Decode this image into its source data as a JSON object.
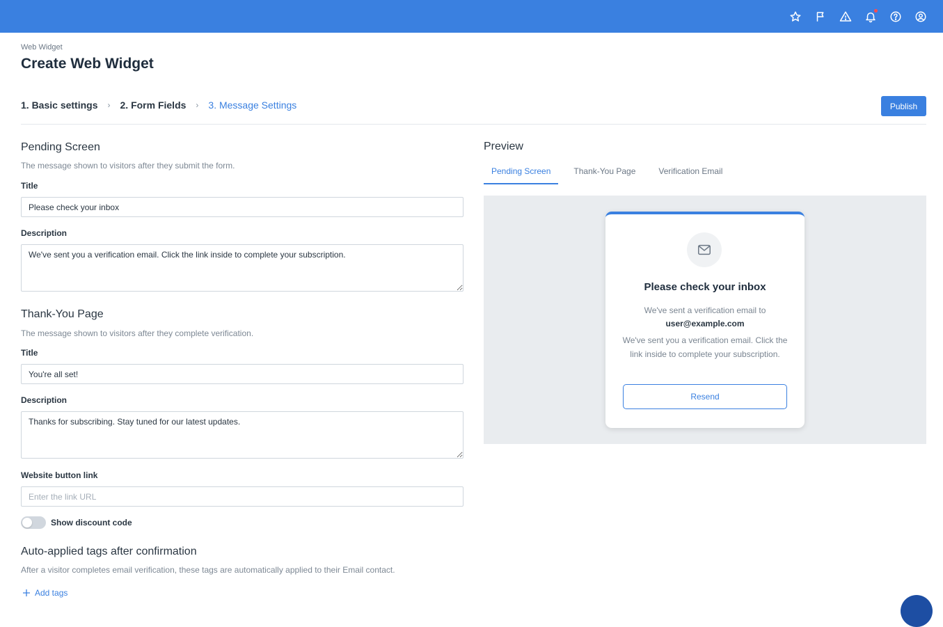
{
  "topbar": {
    "icons": [
      "star-icon",
      "flag-icon",
      "warning-icon",
      "bell-icon",
      "help-icon",
      "user-icon"
    ],
    "brand_color": "#3a80e0"
  },
  "header": {
    "breadcrumb": "Web Widget",
    "title": "Create Web Widget"
  },
  "steps": [
    {
      "label": "1. Basic settings"
    },
    {
      "label": "2. Form Fields"
    },
    {
      "label": "3. Message Settings"
    }
  ],
  "step_separator": "›",
  "publish_label": "Publish",
  "pending": {
    "title": "Pending Screen",
    "subtitle": "The message shown to visitors after they submit the form.",
    "title_label": "Title",
    "title_value": "Please check your inbox",
    "description_label": "Description",
    "description_value": "We've sent you a verification email. Click the link inside to complete your subscription."
  },
  "thankyou": {
    "title": "Thank-You Page",
    "subtitle": "The message shown to visitors after they complete verification.",
    "title_label": "Title",
    "title_value": "You're all set!",
    "description_label": "Description",
    "description_value": "Thanks for subscribing. Stay tuned for our latest updates.",
    "link_label": "Website button link",
    "link_placeholder": "Enter the link URL",
    "discount_label": "Show discount code"
  },
  "tags": {
    "title": "Auto-applied tags after confirmation",
    "subtitle": "After a visitor completes email verification, these tags are automatically applied to their Email contact.",
    "add_label": "Add tags"
  },
  "preview": {
    "title": "Preview",
    "tabs": [
      "Pending Screen",
      "Thank-You Page",
      "Verification Email"
    ],
    "card": {
      "title": "Please check your inbox",
      "sent_to": "We've sent a verification email to",
      "email": "user@example.com",
      "body": "We've sent you a verification email. Click the link inside to complete your subscription.",
      "button": "Resend"
    }
  }
}
